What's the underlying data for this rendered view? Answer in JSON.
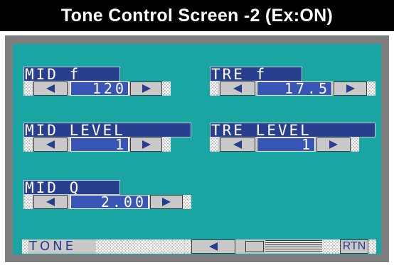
{
  "title": "Tone Control Screen -2 (Ex:ON)",
  "controls": {
    "mid_f": {
      "label": "MID f",
      "value": "120"
    },
    "tre_f": {
      "label": "TRE f",
      "value": "17.5"
    },
    "mid_level": {
      "label": "MID LEVEL",
      "value": "1"
    },
    "tre_level": {
      "label": "TRE LEVEL",
      "value": "1"
    },
    "mid_q": {
      "label": "MID Q",
      "value": "2.00"
    }
  },
  "bottom_bar": {
    "tone_label": "TONE",
    "rtn_label": "RTN"
  },
  "colors": {
    "screen": "#19a5a1",
    "label_bg": "#283e8e",
    "value_bg": "#3955b5",
    "bezel": "#7e7e7e"
  },
  "icons": [
    "left-arrow-icon",
    "right-arrow-icon"
  ]
}
